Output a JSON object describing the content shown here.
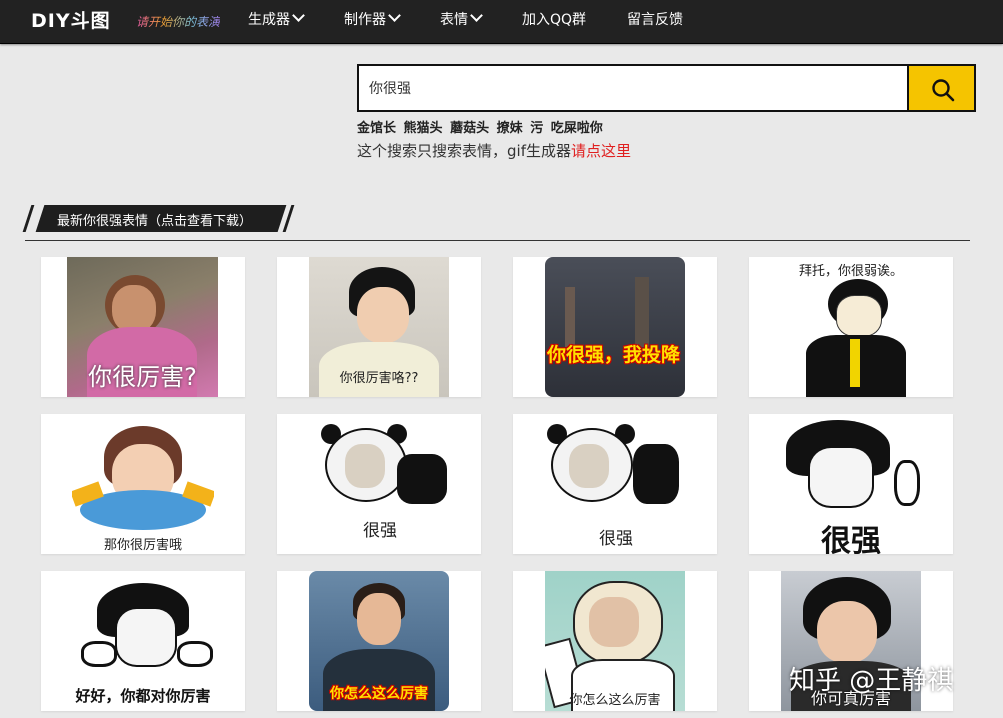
{
  "header": {
    "logo": "DIY斗图",
    "slogan": "请开始你的表演",
    "nav": [
      {
        "label": "生成器",
        "dropdown": true
      },
      {
        "label": "制作器",
        "dropdown": true
      },
      {
        "label": "表情",
        "dropdown": true
      },
      {
        "label": "加入QQ群",
        "dropdown": false
      },
      {
        "label": "留言反馈",
        "dropdown": false
      }
    ]
  },
  "search": {
    "value": "你很强",
    "button_icon": "search-icon",
    "accent": "#f5c400"
  },
  "hotwords": [
    "金馆长",
    "熊猫头",
    "蘑菇头",
    "撩妹",
    "污",
    "吃屎啦你"
  ],
  "gif_note": {
    "text": "这个搜索只搜索表情，gif生成器",
    "link": "请点这里",
    "link_color": "#e02020"
  },
  "section": {
    "title": "最新你很强表情（点击查看下载）"
  },
  "results": [
    {
      "caption": "你很厉害?"
    },
    {
      "caption": "你很厉害咯??"
    },
    {
      "caption": "你很强，我投降"
    },
    {
      "caption": "拜托，你很弱诶。"
    },
    {
      "caption": "那你很厉害哦"
    },
    {
      "caption": "很强"
    },
    {
      "caption": "很强"
    },
    {
      "caption": "很强"
    },
    {
      "caption": "好好，你都对你厉害"
    },
    {
      "caption": "你怎么这么厉害"
    },
    {
      "caption": "你怎么这么厉害"
    },
    {
      "caption": "你可真厉害"
    }
  ],
  "watermark": "知乎 @王静祺"
}
